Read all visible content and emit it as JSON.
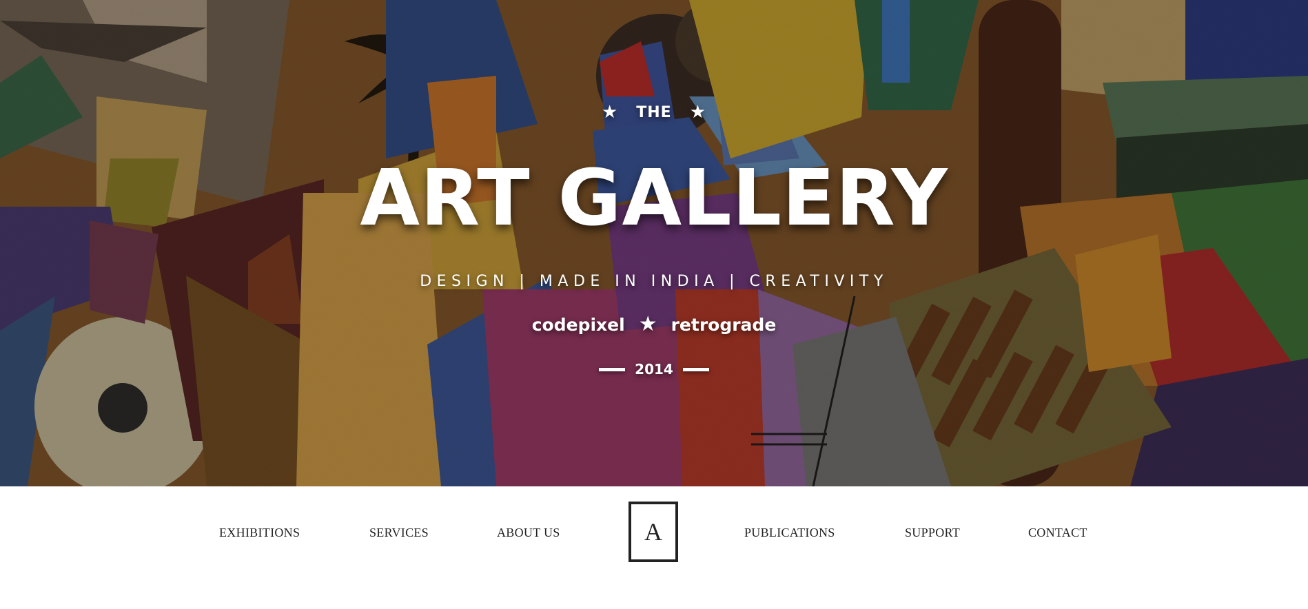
{
  "hero": {
    "pretitle": "THE",
    "title": "ART GALLERY",
    "tagline": "DESIGN | MADE IN INDIA | CREATIVITY",
    "brand_left": "codepixel",
    "brand_right": "retrograde",
    "year": "2014",
    "star_glyph": "★",
    "accent_color": "#ffffff"
  },
  "nav": {
    "items_left": [
      "EXHIBITIONS",
      "SERVICES",
      "ABOUT US"
    ],
    "logo_letter": "A",
    "items_right": [
      "PUBLICATIONS",
      "SUPPORT",
      "CONTACT"
    ],
    "text_color": "#222222"
  }
}
